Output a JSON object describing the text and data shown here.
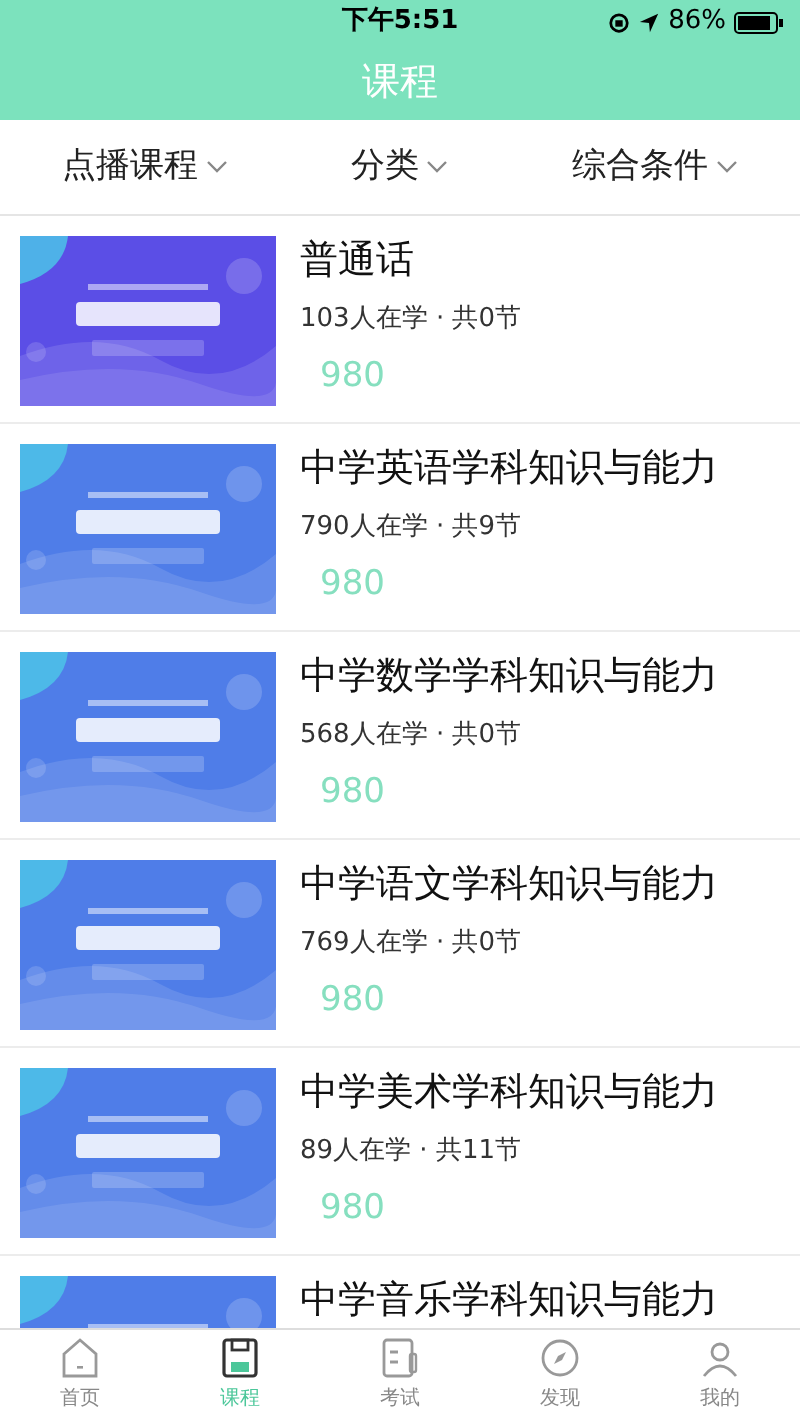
{
  "status_bar": {
    "time": "下午5:51",
    "battery": "86%"
  },
  "header": {
    "title": "课程"
  },
  "filters": [
    {
      "label": "点播课程"
    },
    {
      "label": "分类"
    },
    {
      "label": "综合条件"
    }
  ],
  "courses": [
    {
      "title": "普通话",
      "stats": "103人在学 · 共0节",
      "price": "980",
      "kind": "picture"
    },
    {
      "title": "中学英语学科知识与能力",
      "stats": "790人在学 · 共9节",
      "price": "980",
      "kind": "picture"
    },
    {
      "title": "中学数学学科知识与能力",
      "stats": "568人在学 · 共0节",
      "price": "980",
      "kind": "picture"
    },
    {
      "title": "中学语文学科知识与能力",
      "stats": "769人在学 · 共0节",
      "price": "980",
      "kind": "picture"
    },
    {
      "title": "中学美术学科知识与能力",
      "stats": "89人在学 · 共11节",
      "price": "980",
      "kind": "picture"
    },
    {
      "title": "中学音乐学科知识与能力",
      "kind": "picture"
    }
  ],
  "tab_bar": [
    {
      "label": "首页",
      "selected": false
    },
    {
      "label": "课程",
      "selected": true
    },
    {
      "label": "考试",
      "selected": false
    },
    {
      "label": "发现",
      "selected": false
    },
    {
      "label": "我的",
      "selected": false
    }
  ]
}
